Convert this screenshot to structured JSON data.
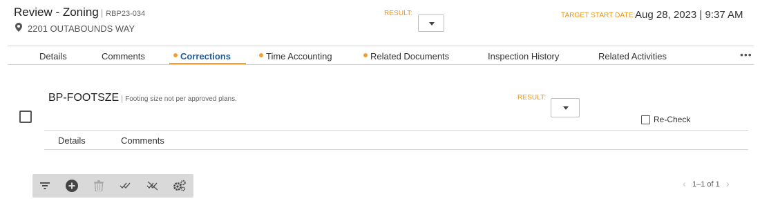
{
  "header": {
    "title": "Review - Zoning",
    "case_number": "RBP23-034",
    "address": "2201 OUTABOUNDS WAY",
    "result_label": "RESULT:",
    "target_start_label": "TARGET START DATE:",
    "target_start_value": "Aug 28, 2023 | 9:37 AM"
  },
  "tabs": [
    {
      "label": "Details",
      "dot": false,
      "active": false
    },
    {
      "label": "Comments",
      "dot": false,
      "active": false
    },
    {
      "label": "Corrections",
      "dot": true,
      "active": true
    },
    {
      "label": "Time Accounting",
      "dot": true,
      "active": false
    },
    {
      "label": "Related Documents",
      "dot": true,
      "active": false
    },
    {
      "label": "Inspection History",
      "dot": false,
      "active": false
    },
    {
      "label": "Related Activities",
      "dot": false,
      "active": false
    }
  ],
  "more_label": "•••",
  "correction": {
    "code": "BP-FOOTSZE",
    "description": "Footing size not per approved plans.",
    "result_label": "RESULT:",
    "recheck_label": "Re-Check",
    "subtabs": [
      "Details",
      "Comments"
    ]
  },
  "toolbar": {
    "icons": [
      "filter-icon",
      "add-icon",
      "delete-icon",
      "check-all-icon",
      "uncheck-all-icon",
      "settings-icon"
    ]
  },
  "pager": {
    "text": "1–1 of 1",
    "prev": "‹",
    "next": "›"
  },
  "colors": {
    "accent_orange": "#f0a030",
    "active_tab_blue": "#1f5d9b",
    "toolbar_bg": "#d9d9d9"
  }
}
